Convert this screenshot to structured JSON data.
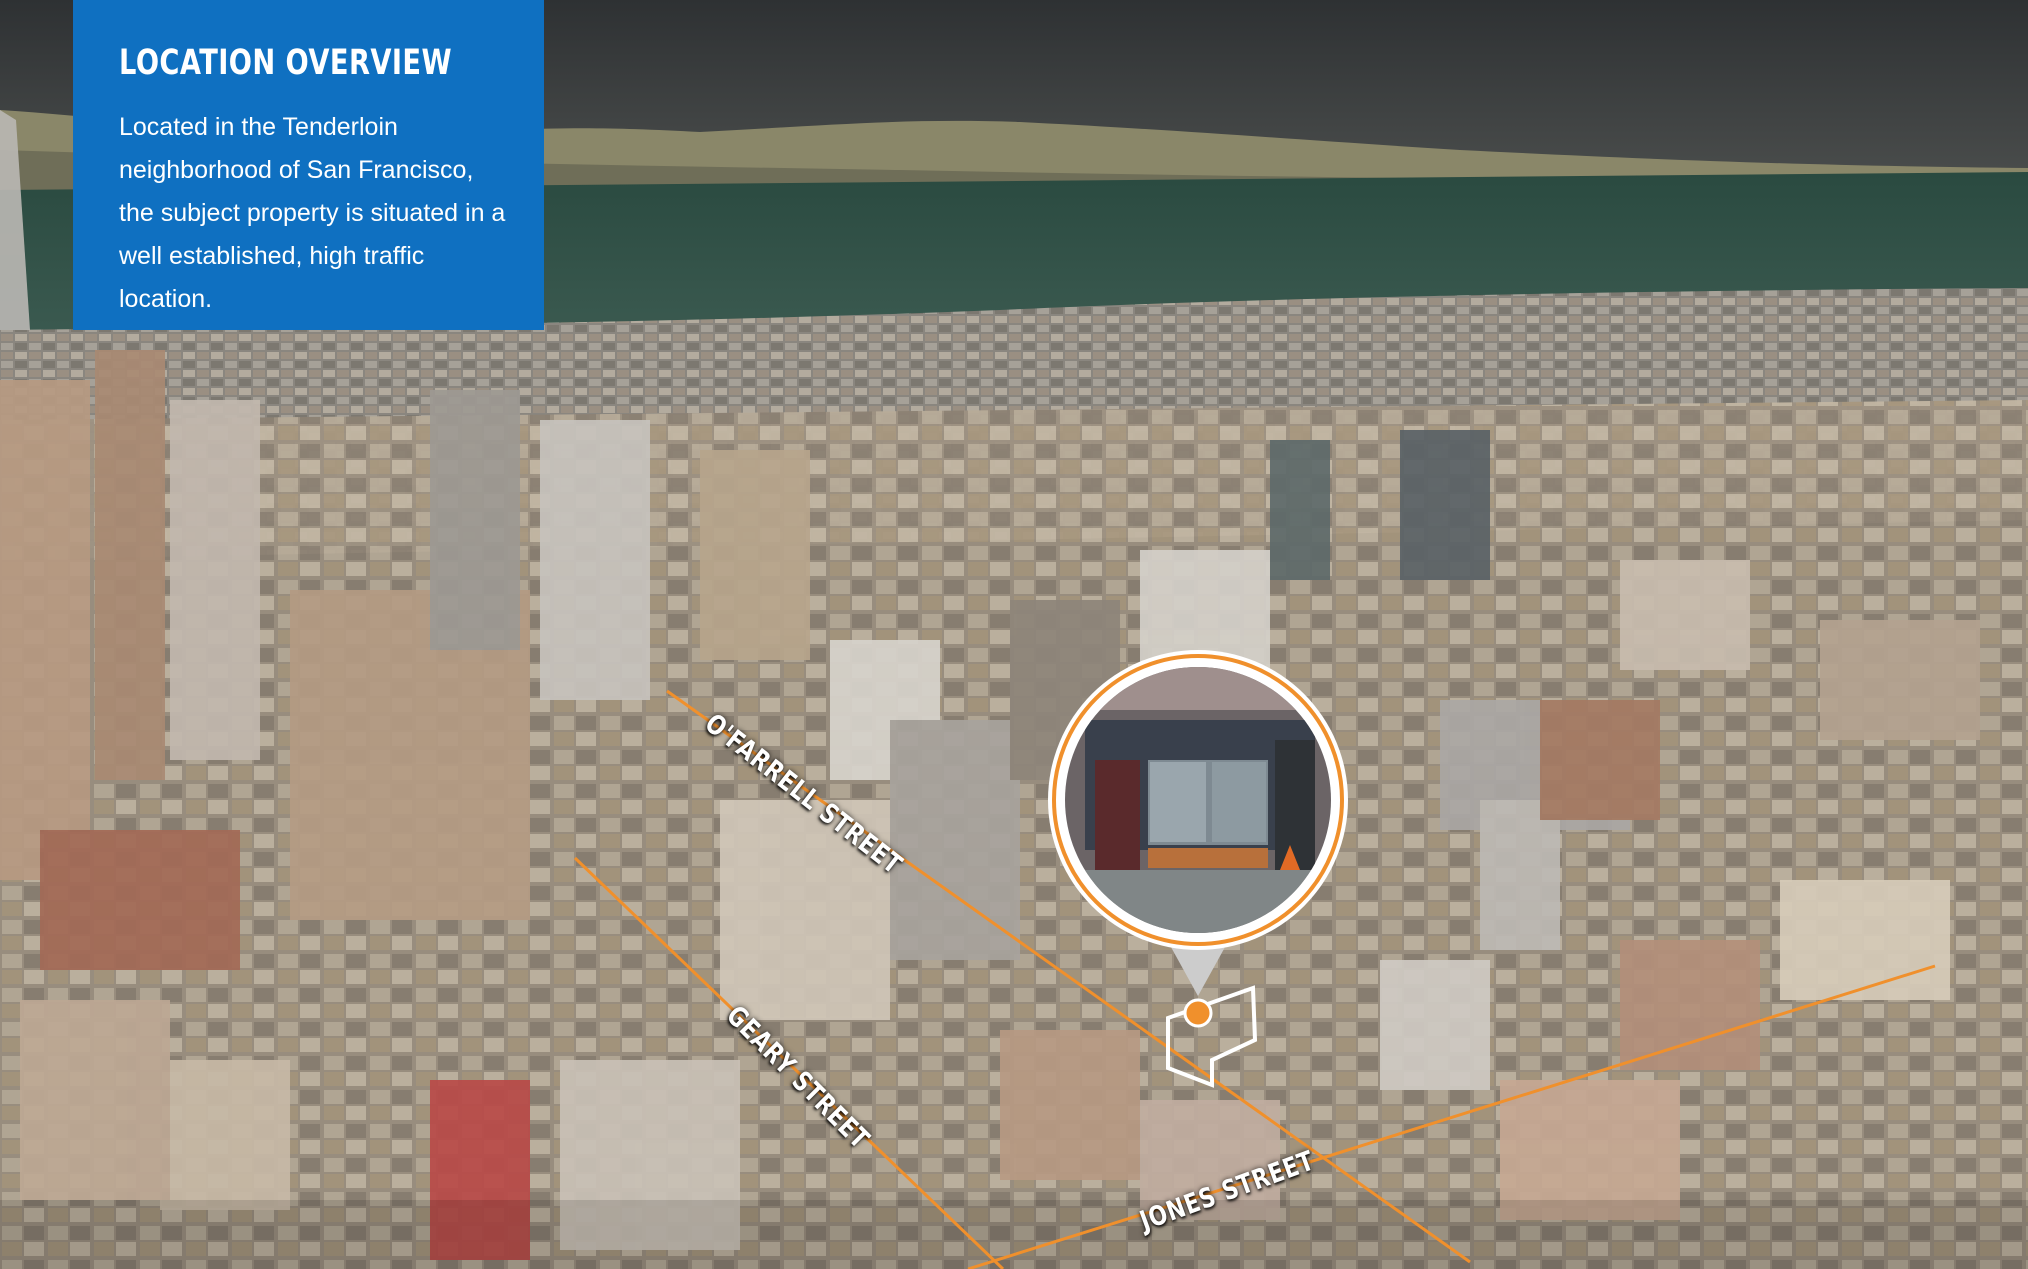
{
  "overview": {
    "title": "LOCATION OVERVIEW",
    "description": "Located in the Tenderloin neighborhood of San Francisco, the subject property is situated in a well established, high traffic location."
  },
  "streets": {
    "ofarrell": "O'FARRELL STREET",
    "geary": "GEARY STREET",
    "jones": "JONES STREET"
  },
  "colors": {
    "panel_blue": "#0f70c1",
    "accent_orange": "#f0902c",
    "water": "#2f5046",
    "hills": "#8a8769",
    "sky": "#3c3f40"
  },
  "icons": {
    "marker": "map-pin-icon",
    "parcel": "parcel-outline-icon"
  }
}
